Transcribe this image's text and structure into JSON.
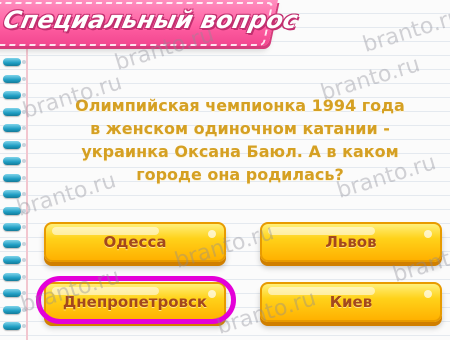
{
  "header": {
    "title": "Специальный вопрос"
  },
  "question": {
    "lines": [
      "Олимпийская чемпионка 1994 года",
      "в женском одиночном катании -",
      "украинка Оксана Баюл. А в каком",
      "городе она родилась?"
    ]
  },
  "answers": [
    {
      "label": "Одесса"
    },
    {
      "label": "Львов"
    },
    {
      "label": "Днепропетровск"
    },
    {
      "label": "Киев"
    }
  ],
  "watermark": {
    "text": "branto.ru"
  },
  "colors": {
    "header_pink": "#ff5fa2",
    "question_text": "#d5a023",
    "button_yellow": "#ffd21a",
    "button_text": "#a3481d",
    "highlight_magenta": "#e400d8",
    "spiral_blue": "#1f9ec3"
  }
}
